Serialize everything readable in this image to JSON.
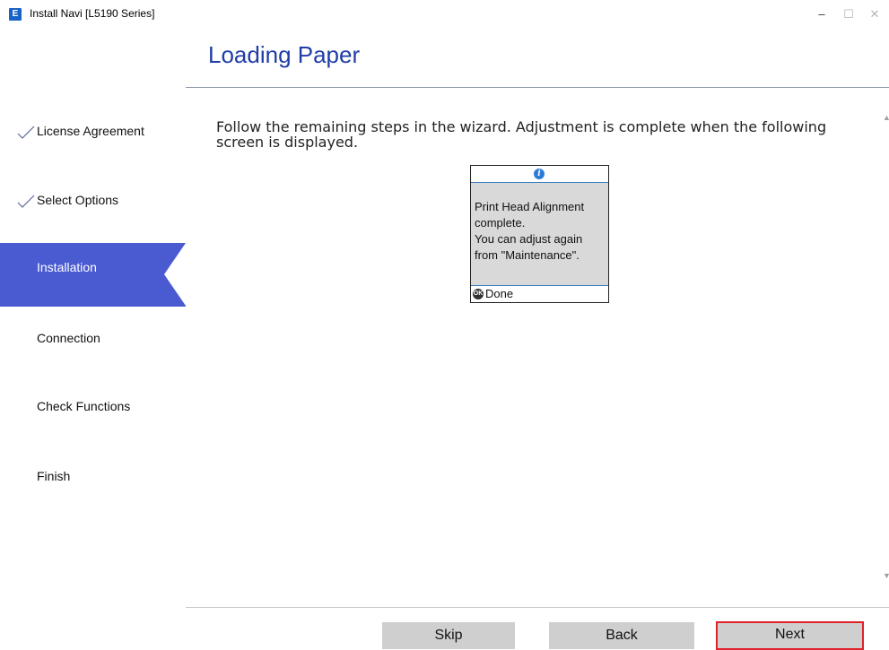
{
  "window": {
    "app_icon_letter": "E",
    "title": "Install Navi [L5190 Series]",
    "controls": {
      "minimize": "–",
      "maximize": "☐",
      "close": "✕"
    }
  },
  "page": {
    "title": "Loading Paper",
    "instruction": "Follow the remaining steps in the wizard. Adjustment is complete when the following screen is displayed."
  },
  "sidebar": {
    "items": [
      {
        "label": "License Agreement",
        "state": "done"
      },
      {
        "label": "Select Options",
        "state": "done"
      },
      {
        "label": "Installation",
        "state": "active"
      },
      {
        "label": "Connection",
        "state": "pending"
      },
      {
        "label": "Check Functions",
        "state": "pending"
      },
      {
        "label": "Finish",
        "state": "pending"
      }
    ]
  },
  "printer_screen": {
    "info_icon": "i",
    "lines": [
      "Print Head Alignment",
      "complete.",
      "You can adjust again",
      "from \"Maintenance\"."
    ],
    "ok_icon": "OK",
    "done_label": "Done"
  },
  "buttons": {
    "skip": "Skip",
    "back": "Back",
    "next": "Next"
  },
  "colors": {
    "accent": "#4a5bd2",
    "title": "#1f3da8",
    "highlight": "#e0202a"
  }
}
